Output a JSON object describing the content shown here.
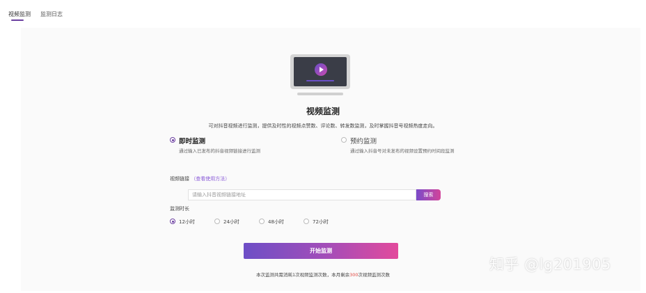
{
  "tabs": [
    {
      "label": "视频监测",
      "active": true
    },
    {
      "label": "监测日志",
      "active": false
    }
  ],
  "hero": {
    "title": "视频监测",
    "description": "可对抖音视频进行监测，提供及时性的视频点赞数、评论数、转发数监测，及时掌握抖音号视频热度走向。"
  },
  "modes": [
    {
      "label": "即时监测",
      "desc": "通过输入已发布的抖音视频链接进行监测",
      "selected": true
    },
    {
      "label": "预约监测",
      "desc": "通过输入抖音号对未发布的视频设置预约时间段监测",
      "selected": false
    }
  ],
  "link": {
    "label": "视频链接",
    "help": "（查看使用方法）",
    "placeholder": "请输入抖音视频链接地址",
    "search_label": "搜索"
  },
  "duration": {
    "label": "监测时长",
    "options": [
      {
        "label": "12小时",
        "selected": true
      },
      {
        "label": "24小时",
        "selected": false
      },
      {
        "label": "48小时",
        "selected": false
      },
      {
        "label": "72小时",
        "selected": false
      }
    ]
  },
  "start_label": "开始监测",
  "quota": {
    "prefix": "本次监测共需消耗1次视频监测次数，本月剩余",
    "remaining": "300",
    "suffix": "次视频监测次数"
  },
  "watermark": "知乎 @lg201905",
  "colors": {
    "accent": "#6b3fa0",
    "gradient_start": "#6d4ec6",
    "gradient_end": "#e24a9c",
    "highlight": "#e0463f"
  }
}
